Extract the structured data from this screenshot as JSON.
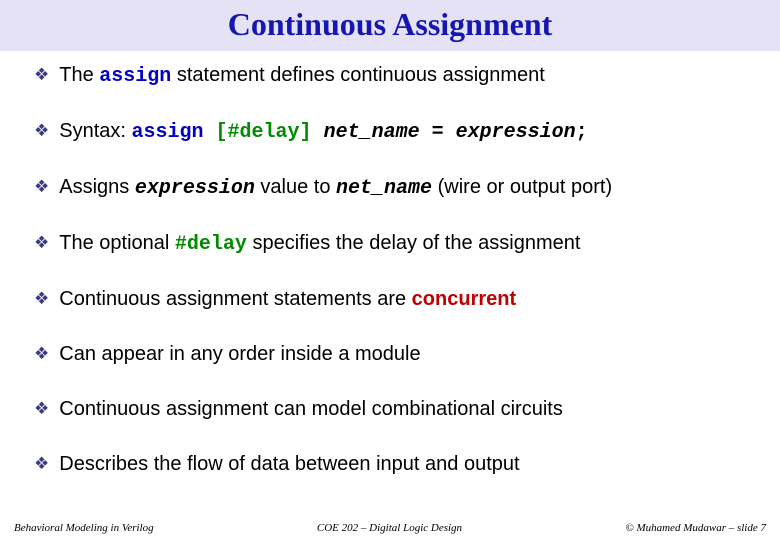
{
  "title": "Continuous Assignment",
  "bullets": {
    "b0": {
      "pre": "The ",
      "kw": "assign",
      "post": " statement defines continuous assignment"
    },
    "b1": {
      "pre": "Syntax: ",
      "kw": "assign ",
      "delay": "[#delay]",
      "mid1": " ",
      "net": "net_name",
      "eq": " = ",
      "expr": "expression",
      "semi": ";"
    },
    "b2": {
      "pre": "Assigns ",
      "expr": "expression",
      "mid": " value to ",
      "net": "net_name",
      "post": " (wire or output port)"
    },
    "b3": {
      "pre": "The optional ",
      "delay": "#delay",
      "post": " specifies the delay of the assignment"
    },
    "b4": {
      "pre": "Continuous assignment statements are ",
      "conc": "concurrent"
    },
    "b5": {
      "text": "Can appear in any order inside a module"
    },
    "b6": {
      "text": "Continuous assignment can model combinational circuits"
    },
    "b7": {
      "text": "Describes the flow of data between input and output"
    }
  },
  "footer": {
    "left": "Behavioral Modeling in Verilog",
    "center": "COE 202 – Digital Logic Design",
    "right": "© Muhamed Mudawar – slide 7"
  }
}
